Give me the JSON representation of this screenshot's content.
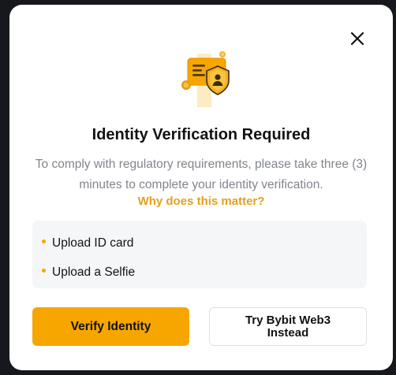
{
  "dialog": {
    "title": "Identity Verification Required",
    "description": "To comply with regulatory requirements, please take three (3) minutes to complete your identity verification.",
    "why_link": "Why does this matter?",
    "steps": [
      {
        "label": "Upload ID card"
      },
      {
        "label": "Upload a Selfie"
      }
    ],
    "primary_button": "Verify Identity",
    "secondary_button": "Try Bybit Web3 Instead",
    "close_icon": "close-icon",
    "hero_icon": "id-card-shield-icon"
  },
  "colors": {
    "accent": "#f7a600",
    "link": "#e59f1c",
    "text": "#121214",
    "muted": "#81858c",
    "panel": "#f5f6f8"
  }
}
